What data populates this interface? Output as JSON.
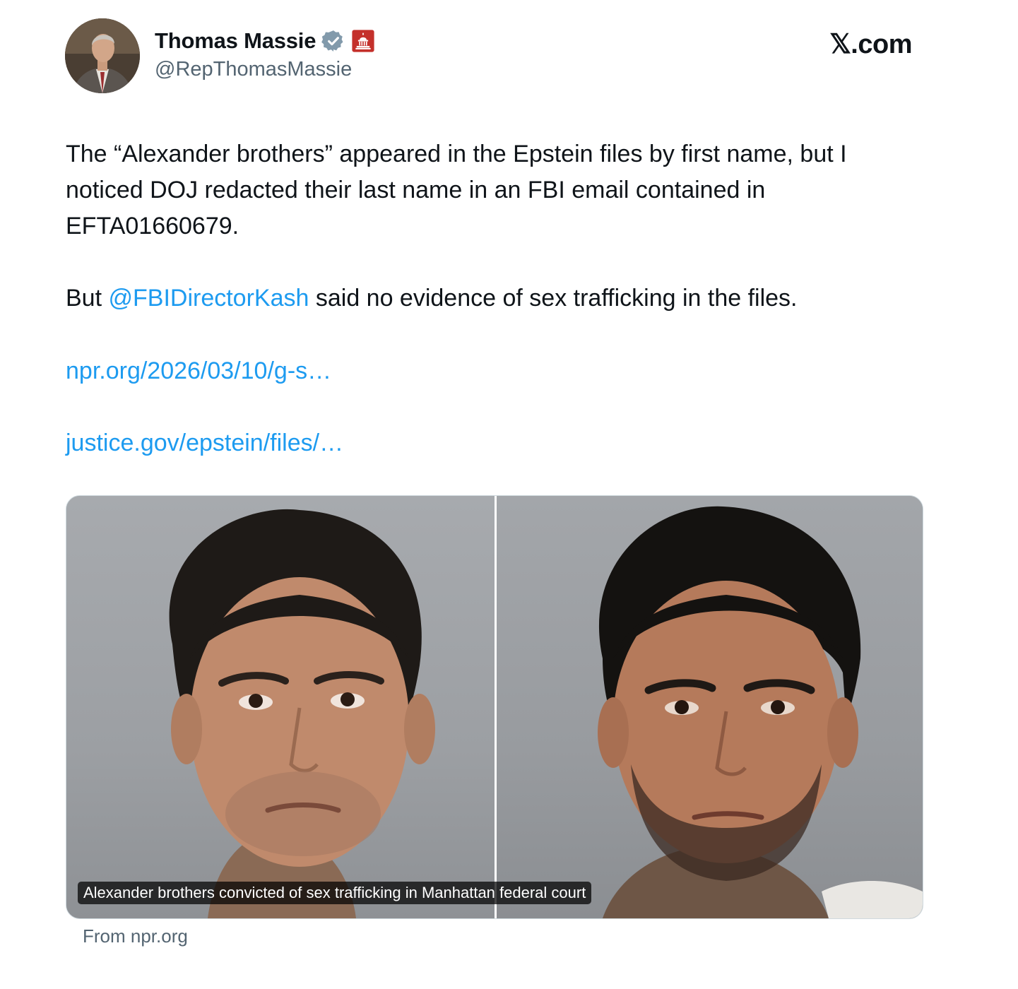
{
  "header": {
    "display_name": "Thomas Massie",
    "handle": "@RepThomasMassie",
    "site_label": "𝕏.com",
    "colors": {
      "verified_badge": "#829aab",
      "gov_badge": "#c4302b"
    }
  },
  "tweet": {
    "paragraph1": "The “Alexander brothers” appeared in the Epstein files by first name, but I noticed DOJ redacted their last name in an FBI email contained in EFTA01660679.",
    "paragraph2_prefix": "But ",
    "mention": "@FBIDirectorKash",
    "paragraph2_suffix": " said no evidence of sex trafficking in the files.",
    "links": [
      "npr.org/2026/03/10/g-s…",
      "justice.gov/epstein/files/…"
    ]
  },
  "card": {
    "caption": "Alexander brothers convicted of sex trafficking in Manhattan federal court",
    "source": "From npr.org"
  },
  "colors": {
    "text": "#0f1419",
    "secondary": "#536471",
    "link": "#1d9bf0"
  }
}
